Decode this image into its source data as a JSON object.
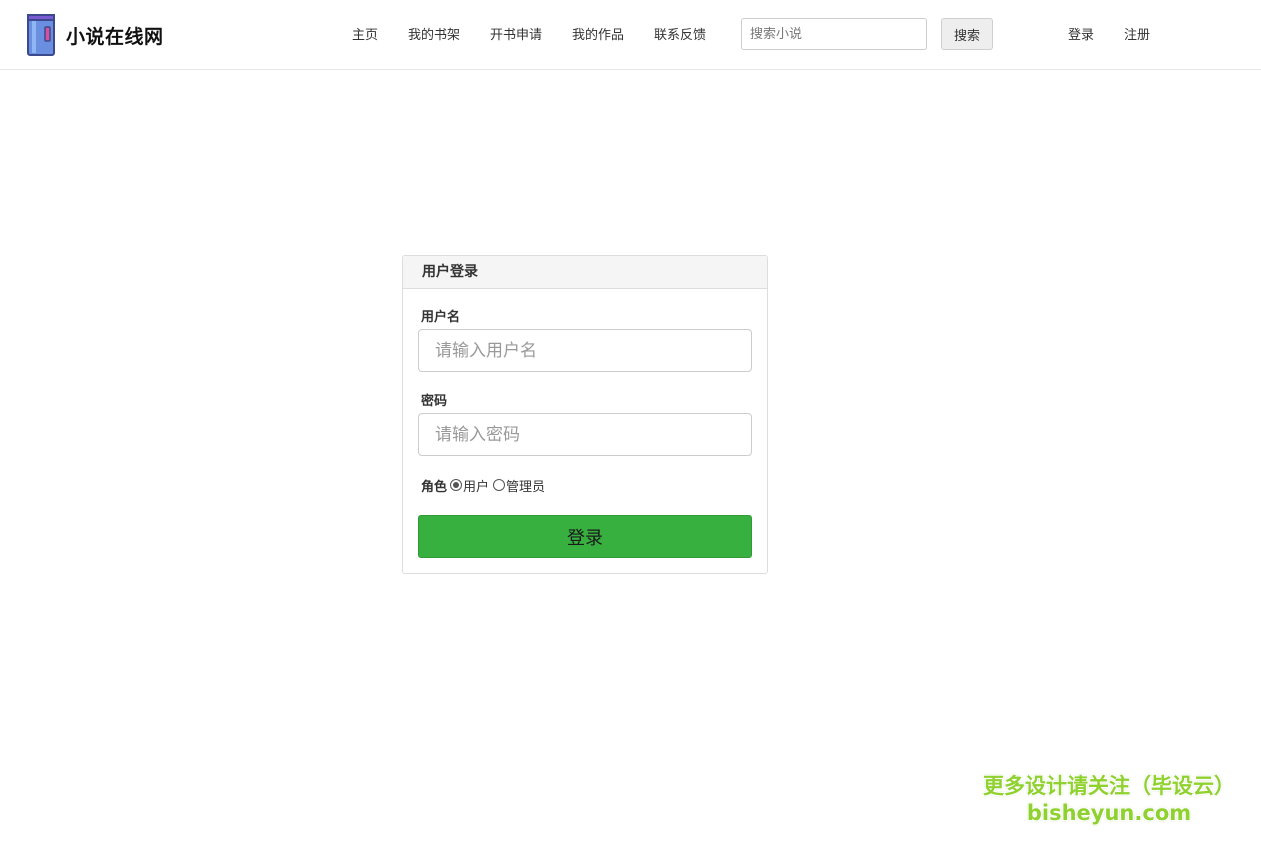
{
  "header": {
    "site_title": "小说在线网",
    "logo_icon": "book-icon",
    "nav": [
      {
        "label": "主页"
      },
      {
        "label": "我的书架"
      },
      {
        "label": "开书申请"
      },
      {
        "label": "我的作品"
      },
      {
        "label": "联系反馈"
      }
    ],
    "search": {
      "placeholder": "搜索小说",
      "value": "",
      "button_label": "搜索"
    },
    "auth": {
      "login_label": "登录",
      "register_label": "注册"
    }
  },
  "login_form": {
    "title": "用户登录",
    "username": {
      "label": "用户名",
      "placeholder": "请输入用户名",
      "value": ""
    },
    "password": {
      "label": "密码",
      "placeholder": "请输入密码",
      "value": ""
    },
    "role": {
      "label": "角色",
      "options": [
        {
          "label": "用户",
          "selected": true
        },
        {
          "label": "管理员",
          "selected": false
        }
      ]
    },
    "submit_label": "登录"
  },
  "watermark": {
    "line1": "更多设计请关注（毕设云）",
    "line2": "bisheyun.com"
  },
  "colors": {
    "login_button": "#38b03f",
    "header_border": "#e6e6e6",
    "card_header_bg": "#f5f5f5",
    "watermark": "#8fd12e",
    "logo_book": "#5a8fd8"
  }
}
